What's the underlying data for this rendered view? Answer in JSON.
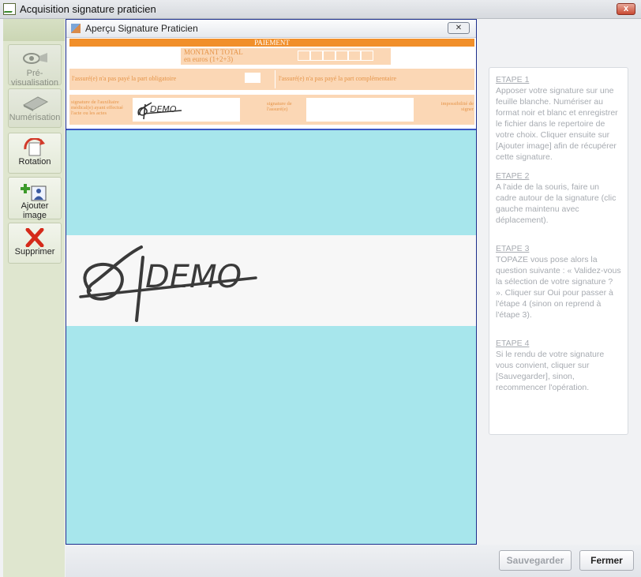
{
  "window": {
    "title": "Acquisition signature praticien",
    "close_label": "x"
  },
  "toolbar": {
    "items": [
      {
        "label": "Pré-visualisation",
        "icon": "eye-icon",
        "enabled": false
      },
      {
        "label": "Numérisation",
        "icon": "scanner-icon",
        "enabled": false
      },
      {
        "label": "Rotation",
        "icon": "rotate-icon",
        "enabled": true
      },
      {
        "label": "Ajouter image",
        "icon": "add-image-icon",
        "enabled": true
      },
      {
        "label": "Supprimer",
        "icon": "delete-icon",
        "enabled": true
      }
    ]
  },
  "preview": {
    "title": "Aperçu Signature Praticien",
    "close_label": "✕",
    "form": {
      "paiement": "PAIEMENT",
      "montant_label_1": "MONTANT TOTAL",
      "montant_label_2": "en euros (1+2+3)",
      "obligatoire": "l'assuré(e) n'a pas payé la part obligatoire",
      "complementaire": "l'assuré(e) n'a pas payé la part complémentaire",
      "sig_aux": "signature de l'auxiliaire médical(e) ayant effectué l'acte ou les actes",
      "sig_assure": "signature de l'assuré(e)",
      "impossibilite": "impossibilité de signer"
    }
  },
  "signature": {
    "text": "DEMO"
  },
  "help": {
    "steps": [
      {
        "title": "ETAPE 1",
        "body": "Apposer votre signature sur une feuille blanche. Numériser au format noir et blanc et enregistrer le fichier dans le repertoire de votre choix. Cliquer ensuite sur [Ajouter image] afin de récupérer cette signature."
      },
      {
        "title": "ETAPE 2",
        "body": "A l'aide de la souris, faire un cadre autour de la signature (clic gauche maintenu avec déplacement)."
      },
      {
        "title": "ETAPE 3",
        "body": "TOPAZE vous pose alors la question suivante : « Validez-vous la sélection de votre signature ? ». Cliquer sur Oui pour passer à l'étape 4 (sinon on reprend à l'étape 3)."
      },
      {
        "title": "ETAPE 4",
        "body": "Si le rendu de votre signature vous convient, cliquer sur [Sauvegarder], sinon, recommencer l'opération."
      }
    ]
  },
  "buttons": {
    "save": "Sauvegarder",
    "close": "Fermer"
  },
  "colors": {
    "canvas": "#a7e6ec",
    "form_orange": "#f18f2a",
    "form_peach": "#fbd7b5",
    "left_panel": "#dfe6cf"
  }
}
